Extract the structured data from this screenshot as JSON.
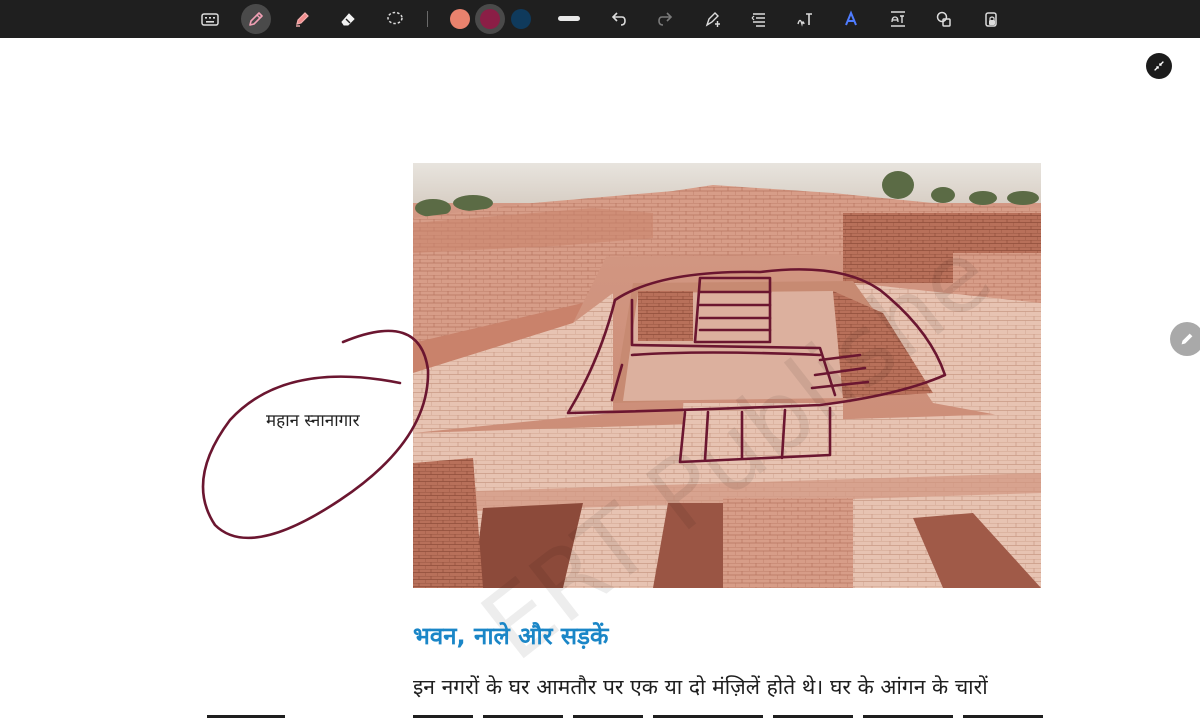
{
  "toolbar": {
    "tools": [
      {
        "name": "keyboard-icon",
        "active": false
      },
      {
        "name": "pen-icon",
        "active": true
      },
      {
        "name": "highlighter-icon",
        "active": false
      },
      {
        "name": "eraser-icon",
        "active": false
      },
      {
        "name": "lasso-select-icon",
        "active": false
      }
    ],
    "colors": [
      "#e9826d",
      "#8b1e46",
      "#0f3a5c"
    ],
    "selected_color": "#8b1e46",
    "actions": [
      "undo-icon",
      "redo-icon",
      "text-box-icon",
      "text-align-icon",
      "handwriting-text-icon",
      "font-style-icon",
      "text-replace-icon",
      "shapes-icon",
      "lock-icon"
    ]
  },
  "document": {
    "caption": "महान स्नानागार",
    "heading": "भवन, नाले और सड़कें",
    "paragraph_line1": "इन नगरों के घर आमतौर पर एक या दो मंज़िलें होते थे। घर के आंगन के चारों",
    "watermark": "ERT Publishe"
  },
  "colors": {
    "ink": "#6b1630",
    "heading": "#1a86c7",
    "toolbar_bg": "#1f1f1f"
  }
}
